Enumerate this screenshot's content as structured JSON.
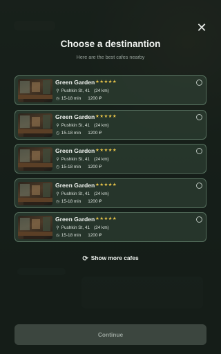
{
  "modal": {
    "title": "Choose a destinantion",
    "subtitle": "Here are the best cafes nearby",
    "close_icon": "✕"
  },
  "cafes": [
    {
      "name": "Green Garden",
      "stars": "★★★★★",
      "address": "Pushkin St, 41",
      "distance": "(24 km)",
      "time": "15-18 min",
      "price": "1200 ₽"
    },
    {
      "name": "Green Garden",
      "stars": "★★★★★",
      "address": "Pushkin St, 41",
      "distance": "(24 km)",
      "time": "15-18 min",
      "price": "1200 ₽"
    },
    {
      "name": "Green Garden",
      "stars": "★★★★★",
      "address": "Pushkin St, 41",
      "distance": "(24 km)",
      "time": "15-18 min",
      "price": "1200 ₽"
    },
    {
      "name": "Green Garden",
      "stars": "★★★★★",
      "address": "Pushkin St, 41",
      "distance": "(24 km)",
      "time": "15-18 min",
      "price": "1200 ₽"
    },
    {
      "name": "Green Garden",
      "stars": "★★★★★",
      "address": "Pushkin St, 41",
      "distance": "(24 km)",
      "time": "15-18 min",
      "price": "1200 ₽"
    }
  ],
  "show_more": {
    "label": "Show more cafes",
    "icon": "refresh-icon"
  },
  "continue_button": {
    "label": "Continue"
  },
  "icons": {
    "location": "location-pin-icon",
    "clock": "clock-icon",
    "radio": "radio-button"
  },
  "colors": {
    "accent_border": "#56705e",
    "star": "#e8c44a",
    "button_disabled": "#5c6860"
  }
}
